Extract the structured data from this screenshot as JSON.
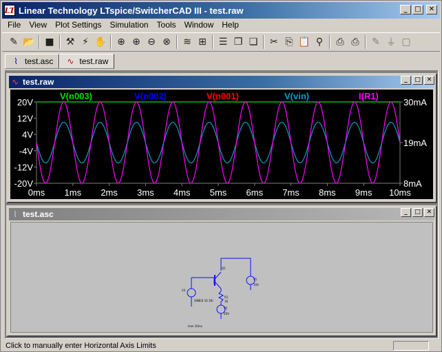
{
  "window": {
    "title": "Linear Technology LTspice/SwitcherCAD III - test.raw",
    "app_icon_glyph": "LT"
  },
  "menu": [
    {
      "label": "File"
    },
    {
      "label": "View"
    },
    {
      "label": "Plot Settings"
    },
    {
      "label": "Simulation"
    },
    {
      "label": "Tools"
    },
    {
      "label": "Window"
    },
    {
      "label": "Help"
    }
  ],
  "toolbar": {
    "icons": [
      "new-schematic-icon",
      "open-icon",
      "save-icon",
      "control-panel-icon",
      "run-icon",
      "halt-icon",
      "zoom-area-icon",
      "zoom-in-icon",
      "zoom-out-icon",
      "zoom-cancel-icon",
      "autorange-icon",
      "pick-traces-icon",
      "tile-horizontal-icon",
      "cascade-icon",
      "close-all-icon",
      "cut-icon",
      "copy-icon",
      "paste-icon",
      "find-icon",
      "print-preview-icon",
      "print-icon",
      "draw-wire-icon",
      "ground-icon",
      "component-icon"
    ]
  },
  "tabs": [
    {
      "label": "test.asc",
      "icon": "schematic-icon",
      "active": false
    },
    {
      "label": "test.raw",
      "icon": "waveform-icon",
      "active": true
    }
  ],
  "waveform_window": {
    "title": "test.raw",
    "traces": [
      {
        "label": "V(n003)",
        "color": "#00e000"
      },
      {
        "label": "V(n002)",
        "color": "#0000ff"
      },
      {
        "label": "V(n001)",
        "color": "#ff0000"
      },
      {
        "label": "V(vin)",
        "color": "#00a0c0"
      },
      {
        "label": "I(R1)",
        "color": "#ff00ff"
      }
    ]
  },
  "chart_data": {
    "type": "line",
    "title": "",
    "xlabel": "",
    "ylabel": "",
    "x_ticks": [
      "0ms",
      "1ms",
      "2ms",
      "3ms",
      "4ms",
      "5ms",
      "6ms",
      "7ms",
      "8ms",
      "9ms",
      "10ms"
    ],
    "y_left_ticks": [
      "20V",
      "12V",
      "4V",
      "-4V",
      "-12V",
      "-20V"
    ],
    "y_right_ticks": [
      "30mA",
      "19mA",
      "8mA"
    ],
    "xlim": [
      0,
      10
    ],
    "ylim_left": [
      -20,
      20
    ],
    "ylim_right": [
      8,
      30
    ],
    "grid": false,
    "series": [
      {
        "name": "V(n003)",
        "axis": "left",
        "type": "constant",
        "value": 20
      },
      {
        "name": "V(vin)",
        "axis": "left",
        "type": "sine",
        "amplitude": 10,
        "offset": 0,
        "freq_khz": 1,
        "phase_deg": 180
      },
      {
        "name": "I(R1)",
        "axis": "right",
        "type": "sine",
        "amplitude": 11,
        "offset": 19,
        "freq_khz": 1,
        "phase_deg": 180
      }
    ]
  },
  "schematic_window": {
    "title": "test.asc",
    "labels": [
      "Q1",
      "R1",
      "V1",
      "V2",
      "V3",
      ".tran 10ms",
      "SINE(0 10 1K)",
      "10V",
      "20V",
      "1K"
    ]
  },
  "status": {
    "text": "Click to manually enter Horizontal Axis Limits"
  },
  "winbtn_glyphs": {
    "min": "_",
    "max": "□",
    "close": "✕"
  }
}
